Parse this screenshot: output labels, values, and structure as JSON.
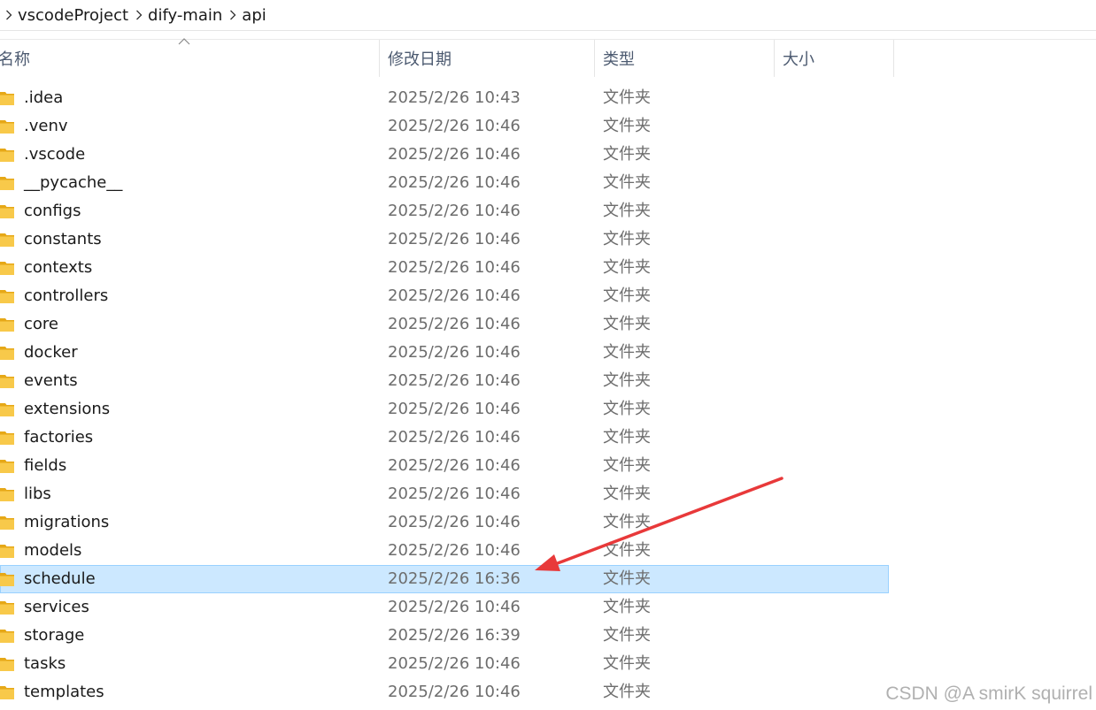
{
  "breadcrumb": {
    "items": [
      "vscodeProject",
      "dify-main",
      "api"
    ]
  },
  "columns": {
    "name": "名称",
    "modified": "修改日期",
    "type": "类型",
    "size": "大小"
  },
  "icons": {
    "folder": "folder-icon",
    "separator": "chevron-right-icon",
    "sort": "sort-ascending-icon"
  },
  "colors": {
    "selection": "#cce8ff",
    "selection_border": "#99d1ff",
    "folder": "#f8c94a",
    "arrow": "#e8393a"
  },
  "files": [
    {
      "name": ".idea",
      "modified": "2025/2/26 10:43",
      "type": "文件夹"
    },
    {
      "name": ".venv",
      "modified": "2025/2/26 10:46",
      "type": "文件夹"
    },
    {
      "name": ".vscode",
      "modified": "2025/2/26 10:46",
      "type": "文件夹"
    },
    {
      "name": "__pycache__",
      "modified": "2025/2/26 10:46",
      "type": "文件夹"
    },
    {
      "name": "configs",
      "modified": "2025/2/26 10:46",
      "type": "文件夹"
    },
    {
      "name": "constants",
      "modified": "2025/2/26 10:46",
      "type": "文件夹"
    },
    {
      "name": "contexts",
      "modified": "2025/2/26 10:46",
      "type": "文件夹"
    },
    {
      "name": "controllers",
      "modified": "2025/2/26 10:46",
      "type": "文件夹"
    },
    {
      "name": "core",
      "modified": "2025/2/26 10:46",
      "type": "文件夹"
    },
    {
      "name": "docker",
      "modified": "2025/2/26 10:46",
      "type": "文件夹"
    },
    {
      "name": "events",
      "modified": "2025/2/26 10:46",
      "type": "文件夹"
    },
    {
      "name": "extensions",
      "modified": "2025/2/26 10:46",
      "type": "文件夹"
    },
    {
      "name": "factories",
      "modified": "2025/2/26 10:46",
      "type": "文件夹"
    },
    {
      "name": "fields",
      "modified": "2025/2/26 10:46",
      "type": "文件夹"
    },
    {
      "name": "libs",
      "modified": "2025/2/26 10:46",
      "type": "文件夹"
    },
    {
      "name": "migrations",
      "modified": "2025/2/26 10:46",
      "type": "文件夹"
    },
    {
      "name": "models",
      "modified": "2025/2/26 10:46",
      "type": "文件夹"
    },
    {
      "name": "schedule",
      "modified": "2025/2/26 16:36",
      "type": "文件夹",
      "selected": true
    },
    {
      "name": "services",
      "modified": "2025/2/26 10:46",
      "type": "文件夹"
    },
    {
      "name": "storage",
      "modified": "2025/2/26 16:39",
      "type": "文件夹"
    },
    {
      "name": "tasks",
      "modified": "2025/2/26 10:46",
      "type": "文件夹"
    },
    {
      "name": "templates",
      "modified": "2025/2/26 10:46",
      "type": "文件夹"
    }
  ],
  "watermark": "CSDN @A smirK squirrel"
}
